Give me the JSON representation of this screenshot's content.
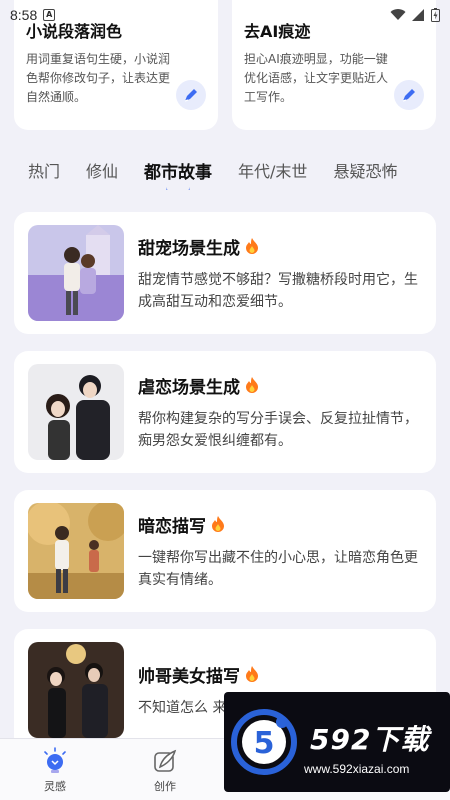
{
  "status": {
    "time": "8:58",
    "notif_letter": "A"
  },
  "feature_cards": [
    {
      "title": "小说段落润色",
      "desc": "用词重复语句生硬，小说润色帮你修改句子，让表达更自然通顺。"
    },
    {
      "title": "去AI痕迹",
      "desc": "担心AI痕迹明显，功能一键优化语感，让文字更贴近人工写作。"
    }
  ],
  "tabs": [
    "热门",
    "修仙",
    "都市故事",
    "年代/末世",
    "悬疑恐怖"
  ],
  "active_tab": "都市故事",
  "scenes": [
    {
      "title": "甜宠场景生成",
      "desc": "甜宠情节感觉不够甜？写撒糖桥段时用它，生成高甜互动和恋爱细节。"
    },
    {
      "title": "虐恋场景生成",
      "desc": "帮你构建复杂的写分手误会、反复拉扯情节，痴男怨女爱恨纠缠都有。"
    },
    {
      "title": "暗恋描写",
      "desc": "一键帮你写出藏不住的小心思，让暗恋角色更真实有情绪。"
    },
    {
      "title": "帅哥美女描写",
      "desc": "不知道怎么 来？帮你写"
    }
  ],
  "nav": [
    {
      "label": "灵感",
      "icon": "bulb-icon"
    },
    {
      "label": "创作",
      "icon": "quill-icon"
    }
  ],
  "watermark": {
    "brand": "592下载",
    "url": "www.592xiazai.com",
    "logo_digit": "5"
  },
  "colors": {
    "accent": "#3d6cf2",
    "background": "#f1f1f8",
    "card": "#ffffff",
    "fire": "#ff7a1a"
  }
}
